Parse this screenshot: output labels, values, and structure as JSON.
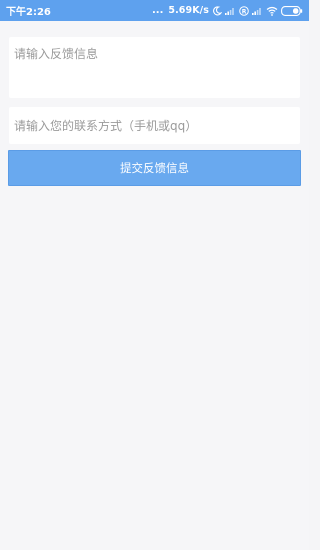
{
  "status_bar": {
    "time": "下午2:26",
    "dots": "...",
    "speed": "5.69K/s",
    "icons": [
      "moon-icon",
      "signal-icon",
      "registered-icon",
      "signal-icon",
      "wifi-icon",
      "battery-icon"
    ],
    "registered": "R"
  },
  "form": {
    "feedback_placeholder": "请输入反馈信息",
    "contact_placeholder": "请输入您的联系方式（手机或qq）",
    "submit_label": "提交反馈信息"
  },
  "colors": {
    "status_bar": "#5ea1ee",
    "button": "#69a9ef",
    "background": "#f6f6f8"
  }
}
